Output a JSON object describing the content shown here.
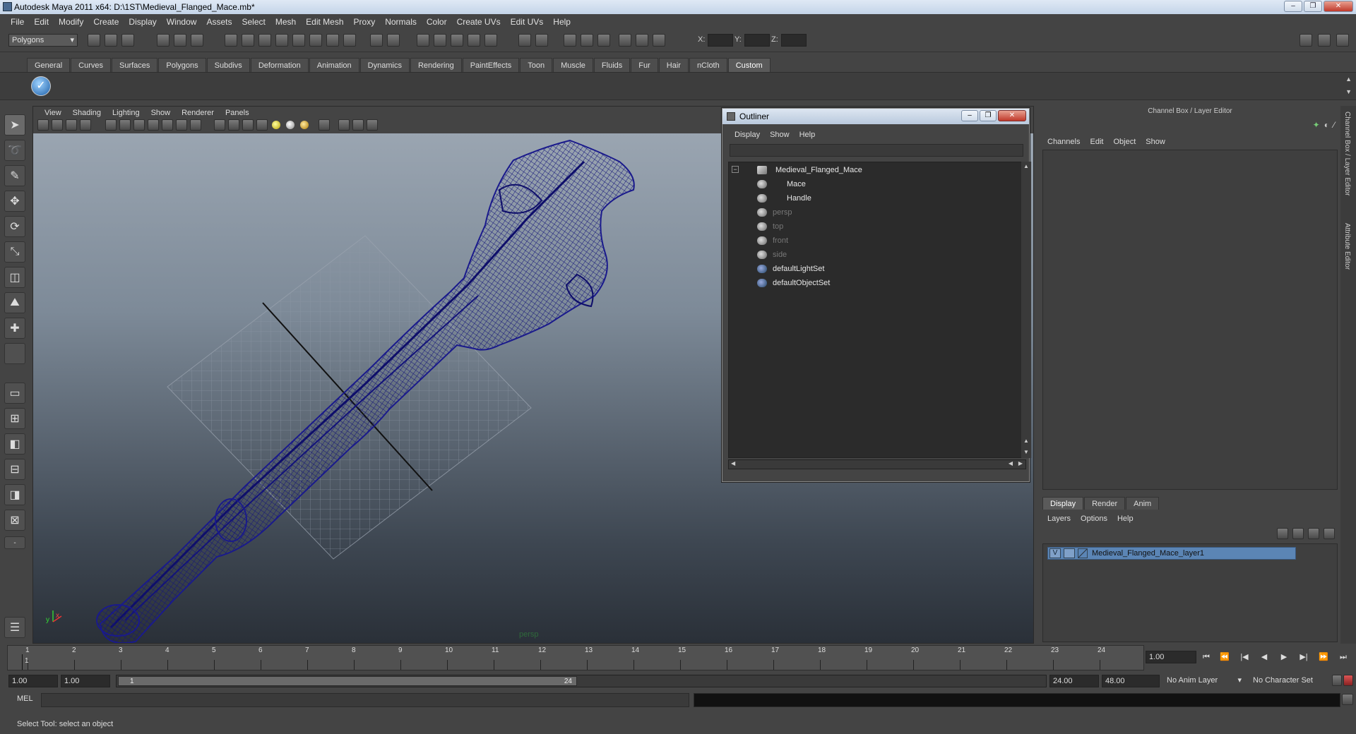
{
  "window": {
    "title": "Autodesk Maya 2011 x64: D:\\1ST\\Medieval_Flanged_Mace.mb*",
    "controls": [
      "–",
      "❐",
      "✕"
    ]
  },
  "menubar": [
    "File",
    "Edit",
    "Modify",
    "Create",
    "Display",
    "Window",
    "Assets",
    "Select",
    "Mesh",
    "Edit Mesh",
    "Proxy",
    "Normals",
    "Color",
    "Create UVs",
    "Edit UVs",
    "Help"
  ],
  "statusline": {
    "mode": "Polygons",
    "x_label": "X:",
    "y_label": "Y:",
    "z_label": "Z:"
  },
  "shelf_tabs": [
    "General",
    "Curves",
    "Surfaces",
    "Polygons",
    "Subdivs",
    "Deformation",
    "Animation",
    "Dynamics",
    "Rendering",
    "PaintEffects",
    "Toon",
    "Muscle",
    "Fluids",
    "Fur",
    "Hair",
    "nCloth",
    "Custom"
  ],
  "shelf_active": "Custom",
  "viewport": {
    "menu": [
      "View",
      "Shading",
      "Lighting",
      "Show",
      "Renderer",
      "Panels"
    ],
    "camera_label": "persp",
    "axis_x": "x",
    "axis_y": "y",
    "wire_color": "#1a1a8c"
  },
  "outliner": {
    "title": "Outliner",
    "menu": [
      "Display",
      "Show",
      "Help"
    ],
    "items": [
      {
        "label": "Medieval_Flanged_Mace",
        "icon": "mesh-group-icon",
        "dim": false
      },
      {
        "label": "Mace",
        "icon": "mesh-icon",
        "dim": false
      },
      {
        "label": "Handle",
        "icon": "mesh-icon",
        "dim": false
      },
      {
        "label": "persp",
        "icon": "camera-icon",
        "dim": true
      },
      {
        "label": "top",
        "icon": "camera-icon",
        "dim": true
      },
      {
        "label": "front",
        "icon": "camera-icon",
        "dim": true
      },
      {
        "label": "side",
        "icon": "camera-icon",
        "dim": true
      },
      {
        "label": "defaultLightSet",
        "icon": "set-icon",
        "dim": false
      },
      {
        "label": "defaultObjectSet",
        "icon": "set-icon",
        "dim": false
      }
    ]
  },
  "channel_box": {
    "title": "Channel Box / Layer Editor",
    "menu": [
      "Channels",
      "Edit",
      "Object",
      "Show"
    ],
    "layer_tabs": [
      "Display",
      "Render",
      "Anim"
    ],
    "layer_menu": [
      "Layers",
      "Options",
      "Help"
    ],
    "layer": {
      "visibility": "V",
      "name": "Medieval_Flanged_Mace_layer1"
    },
    "side_tabs": [
      "Channel Box / Layer Editor",
      "Attribute Editor"
    ]
  },
  "timeline": {
    "ticks": [
      "1",
      "2",
      "3",
      "4",
      "5",
      "6",
      "7",
      "8",
      "9",
      "10",
      "11",
      "12",
      "13",
      "14",
      "15",
      "16",
      "17",
      "18",
      "19",
      "20",
      "21",
      "22",
      "23",
      "24"
    ],
    "current_marker": "1",
    "current_frame": "1.00"
  },
  "range": {
    "start": "1.00",
    "playback_start": "1.00",
    "slider_start": "1",
    "slider_end": "24",
    "playback_end": "24.00",
    "end": "48.00",
    "anim_layer": "No Anim Layer",
    "character_set": "No Character Set"
  },
  "cmdline": {
    "label": "MEL"
  },
  "helpline": {
    "text": "Select Tool: select an object"
  }
}
